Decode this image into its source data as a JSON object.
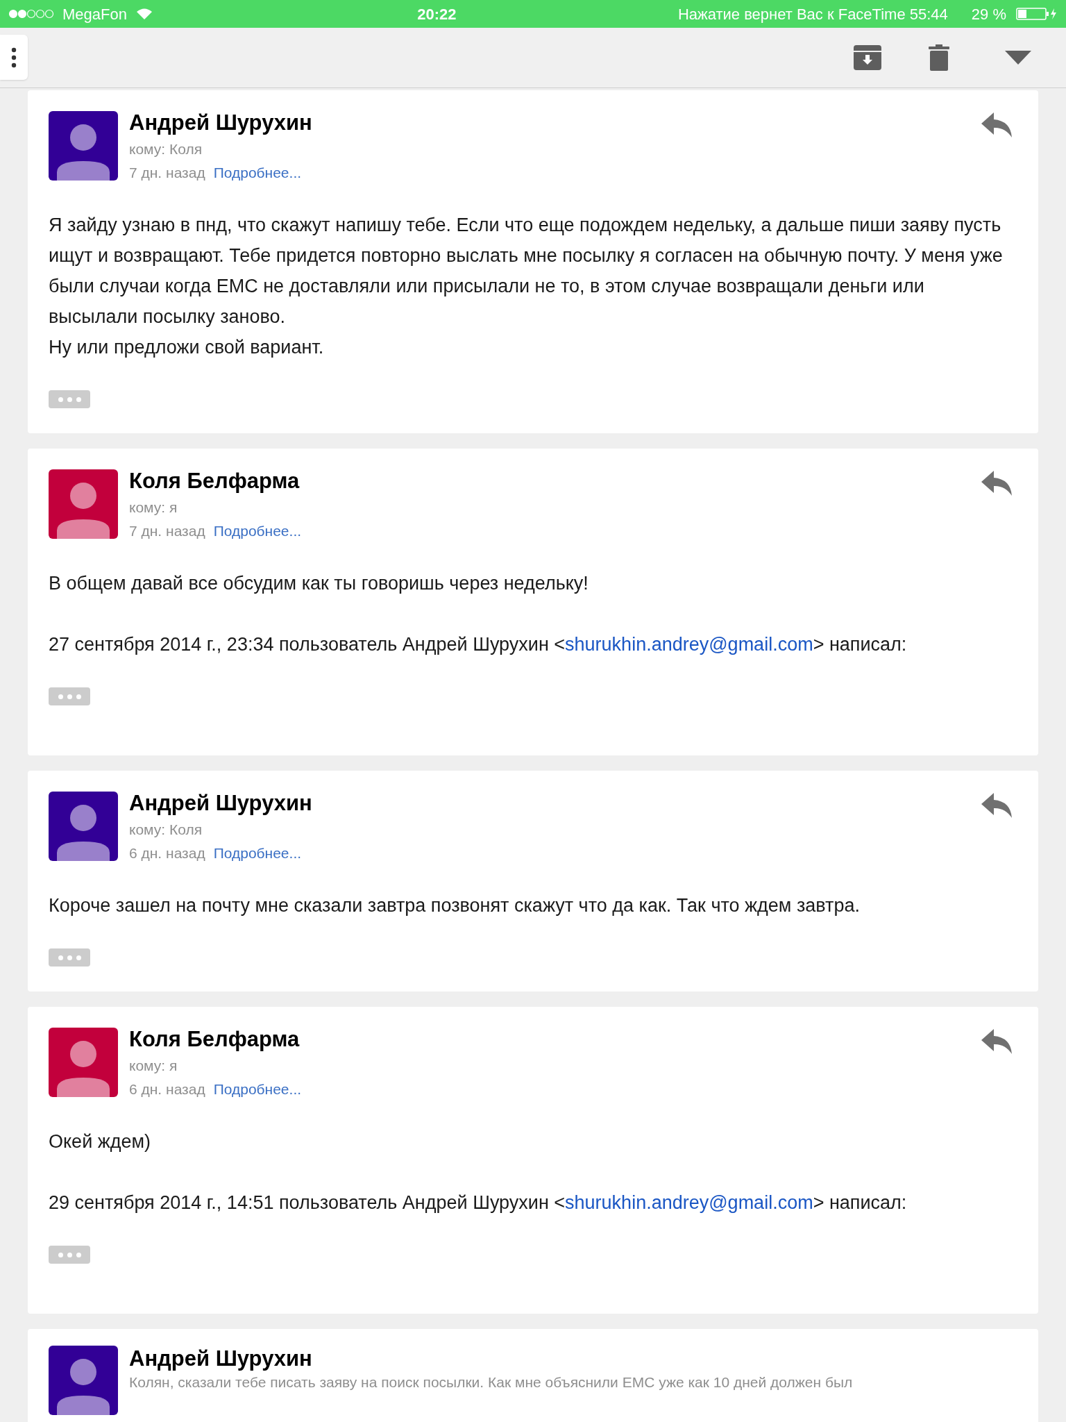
{
  "status_bar": {
    "carrier": "MegaFon",
    "time": "20:22",
    "facetime": "Нажатие вернет Вас к FaceTime 55:44",
    "battery": "29 %"
  },
  "messages": [
    {
      "kind": "full",
      "sender": "Андрей Шурухин",
      "color": "#320096",
      "to": "кому: Коля",
      "date": "7 дн. назад",
      "details": "Подробнее...",
      "body": [
        "Я зайду узнаю в пнд, что скажут напишу тебе. Если что еще подождем недельку, а дальше пиши заяву пусть ищут и возвращают. Тебе придется повторно выслать мне посылку я согласен на обычную почту. У меня уже были случаи когда ЕМС не доставляли или присылали не то, в этом случае возвращали деньги или высылали посылку заново.",
        "Ну или предложи свой вариант."
      ]
    },
    {
      "kind": "full",
      "sender": "Коля Белфарма",
      "color": "#c2003c",
      "to": "кому: я",
      "date": "7 дн. назад",
      "details": "Подробнее...",
      "body": [
        "В общем давай все обсудим как ты говоришь через недельку!"
      ],
      "quote": {
        "prefix": "27 сентября 2014 г., 23:34 пользователь Андрей Шурухин <",
        "email": "shurukhin.andrey@gmail.com",
        "suffix": "> написал:"
      }
    },
    {
      "kind": "full",
      "sender": "Андрей Шурухин",
      "color": "#320096",
      "to": "кому: Коля",
      "date": "6 дн. назад",
      "details": "Подробнее...",
      "body": [
        "Короче зашел на почту мне сказали завтра позвонят скажут что да как. Так что ждем завтра."
      ]
    },
    {
      "kind": "full",
      "sender": "Коля Белфарма",
      "color": "#c2003c",
      "to": "кому: я",
      "date": "6 дн. назад",
      "details": "Подробнее...",
      "body": [
        "Окей ждем)"
      ],
      "quote": {
        "prefix": "29 сентября 2014 г., 14:51 пользователь Андрей Шурухин <",
        "email": "shurukhin.andrey@gmail.com",
        "suffix": "> написал:"
      }
    },
    {
      "kind": "collapsed",
      "sender": "Андрей Шурухин",
      "color": "#320096",
      "snippet": "Колян, сказали тебе писать заяву на поиск посылки. Как мне объяснили ЕМС уже как 10 дней должен был"
    }
  ]
}
